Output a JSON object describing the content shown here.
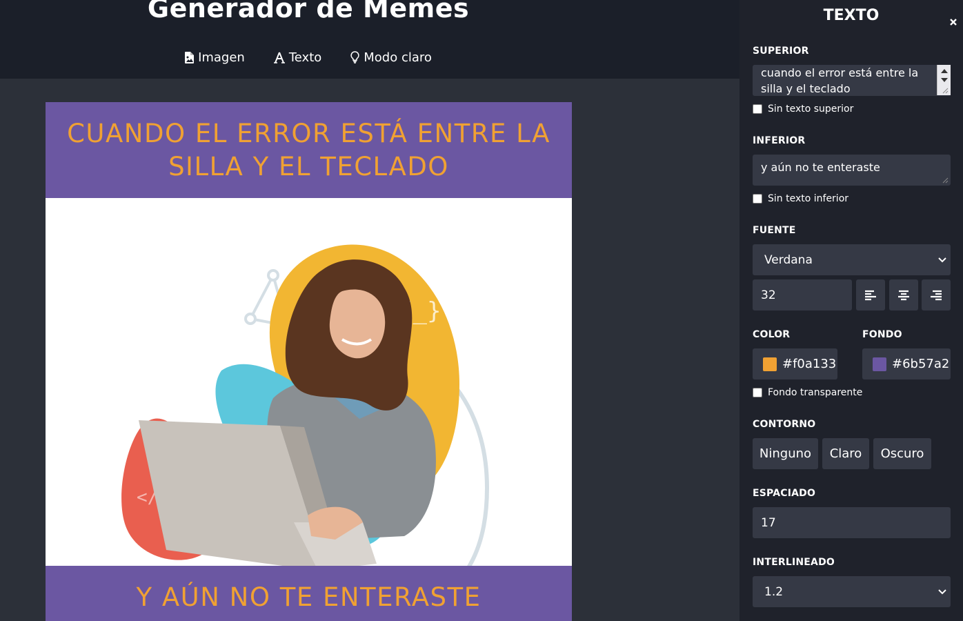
{
  "header": {
    "title": "Generador de Memes",
    "nav": [
      {
        "label": "Imagen",
        "icon": "image-file-icon"
      },
      {
        "label": "Texto",
        "icon": "font-icon"
      },
      {
        "label": "Modo claro",
        "icon": "lightbulb-icon"
      }
    ]
  },
  "meme": {
    "top_text": "Cuando el error está entre la silla y el teclado",
    "bottom_text": "y aún no te enteraste",
    "text_color": "#f0a133",
    "background_color": "#6b57a2"
  },
  "sidebar": {
    "title": "TEXTO",
    "close_icon": "close-icon",
    "top": {
      "label": "SUPERIOR",
      "value": "cuando el error está entre la silla y el teclado",
      "checkbox_label": "Sin texto superior",
      "checked": false
    },
    "bottom": {
      "label": "INFERIOR",
      "value": "y aún no te enteraste",
      "checkbox_label": "Sin texto inferior",
      "checked": false
    },
    "font": {
      "label": "FUENTE",
      "selected": "Verdana",
      "size": "32",
      "align_icons": [
        "align-left-icon",
        "align-center-icon",
        "align-right-icon"
      ]
    },
    "color": {
      "label": "COLOR",
      "value": "#f0a133"
    },
    "background": {
      "label": "FONDO",
      "value": "#6b57a2",
      "checkbox_label": "Fondo transparente",
      "checked": false
    },
    "outline": {
      "label": "CONTORNO",
      "options": [
        "Ninguno",
        "Claro",
        "Oscuro"
      ]
    },
    "spacing": {
      "label": "ESPACIADO",
      "value": "17"
    },
    "line_height": {
      "label": "INTERLINEADO",
      "selected": "1.2"
    }
  }
}
